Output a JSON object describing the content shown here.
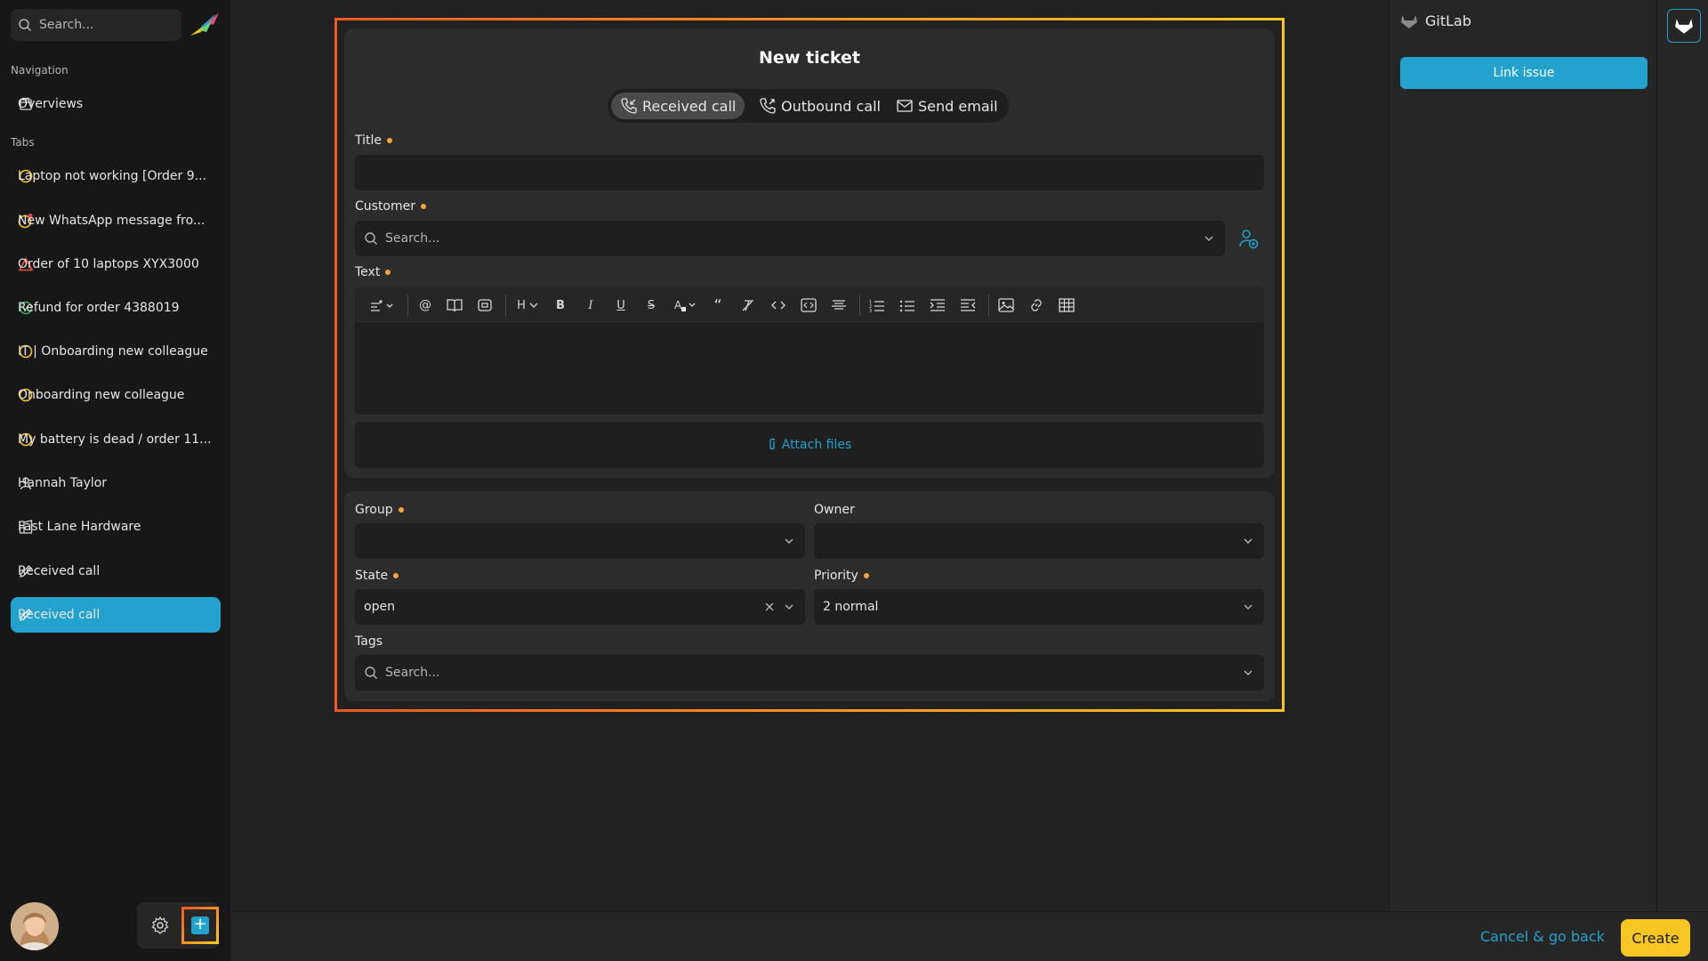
{
  "colors": {
    "accent": "#23a2cd",
    "primary_button": "#f7c623",
    "required_dot": "#f7a33b",
    "highlight_start": "#f05a24",
    "highlight_end": "#f7c623"
  },
  "sidebar": {
    "search_placeholder": "Search...",
    "nav_heading": "Navigation",
    "nav_items": [
      {
        "label": "Overviews",
        "icon": "overviews-icon"
      }
    ],
    "tabs_heading": "Tabs",
    "tabs": [
      {
        "label": "Laptop not working [Order 9...",
        "icon": "ticket-open-icon"
      },
      {
        "label": "New WhatsApp message fro...",
        "icon": "ticket-new-icon"
      },
      {
        "label": "Order of 10 laptops XYX3000",
        "icon": "ticket-escalated-icon"
      },
      {
        "label": "Refund for order 4388019",
        "icon": "ticket-closed-icon"
      },
      {
        "label": "IT | Onboarding new colleague",
        "icon": "ticket-open-icon"
      },
      {
        "label": "Onboarding new colleague",
        "icon": "ticket-open-icon"
      },
      {
        "label": "My battery is dead / order 11...",
        "icon": "ticket-open-icon"
      },
      {
        "label": "Hannah Taylor",
        "icon": "user-icon"
      },
      {
        "label": "Fast Lane Hardware",
        "icon": "organization-icon"
      },
      {
        "label": "Received call",
        "icon": "pencil-icon"
      },
      {
        "label": "Received call",
        "icon": "pencil-icon",
        "active": true
      }
    ]
  },
  "form": {
    "title": "New ticket",
    "ticket_types": [
      {
        "label": "Received call",
        "icon": "phone-incoming-icon",
        "active": true
      },
      {
        "label": "Outbound call",
        "icon": "phone-outgoing-icon"
      },
      {
        "label": "Send email",
        "icon": "mail-icon"
      }
    ],
    "title_label": "Title",
    "customer_label": "Customer",
    "customer_placeholder": "Search...",
    "text_label": "Text",
    "attach_label": "Attach files",
    "group_label": "Group",
    "owner_label": "Owner",
    "state_label": "State",
    "state_value": "open",
    "priority_label": "Priority",
    "priority_value": "2 normal",
    "tags_label": "Tags",
    "tags_placeholder": "Search..."
  },
  "toolbar": {
    "heading_label": "H"
  },
  "right_panel": {
    "title": "GitLab",
    "link_issue_label": "Link issue"
  },
  "footer": {
    "cancel_label": "Cancel & go back",
    "create_label": "Create"
  }
}
